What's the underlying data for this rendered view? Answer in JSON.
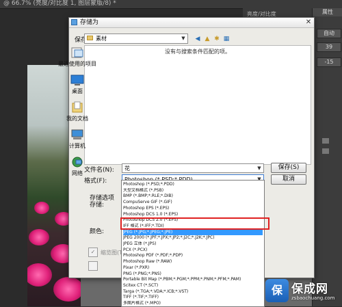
{
  "app": {
    "window_title": "@ 66.7% (亮度/对比度 1, 图层蒙版/8) *",
    "panel_tab": "属性",
    "panel_header": "亮度/对比度",
    "panel_btn": "自动",
    "panel_value_1": "39",
    "panel_value_2": "-15"
  },
  "dialog": {
    "title": "存储为",
    "close_glyph": "✕",
    "save_in_label": "保存在(I):",
    "save_in_value": "素材",
    "empty_message": "没有与搜索条件匹配的项。",
    "places": [
      {
        "label": "最近使用的项目",
        "icon": "recent-icon"
      },
      {
        "label": "桌面",
        "icon": "desktop-icon"
      },
      {
        "label": "我的文档",
        "icon": "documents-icon"
      },
      {
        "label": "计算机",
        "icon": "computer-icon"
      },
      {
        "label": "网络",
        "icon": "network-icon"
      }
    ],
    "filename_label": "文件名(N):",
    "filename_value": "花",
    "format_label": "格式(F):",
    "format_value": "Photoshop (*.PSD;*.PDD)",
    "save_button": "保存(S)",
    "cancel_button": "取消",
    "options_label": "存储选项",
    "storage_label": "存储:",
    "color_label": "颜色:",
    "thumbnail_label": "缩览图(T)",
    "format_options": [
      "Photoshop (*.PSD;*.PDD)",
      "大型文档格式 (*.PSB)",
      "BMP (*.BMP;*.RLE;*.DIB)",
      "CompuServe GIF (*.GIF)",
      "Photoshop EPS (*.EPS)",
      "Photoshop DCS 1.0 (*.EPS)",
      "Photoshop DCS 2.0 (*.EPS)",
      "IFF 格式 (*.IFF;*.TDI)",
      "JPEG (*.JPG;*.JPEG;*.JPE)",
      "JPEG 2000 (*.JPF;*.JPX;*.JP2;*.J2C;*.J2K;*.JPC)",
      "JPEG 立体 (*.JPS)",
      "PCX (*.PCX)",
      "Photoshop PDF (*.PDF;*.PDP)",
      "Photoshop Raw (*.RAW)",
      "Pixar (*.PXR)",
      "PNG (*.PNG;*.PNS)",
      "Portable Bit Map (*.PBM;*.PGM;*.PPM;*.PNM;*.PFM;*.PAM)",
      "Scitex CT (*.SCT)",
      "Targa (*.TGA;*.VDA;*.ICB;*.VST)",
      "TIFF (*.TIF;*.TIFF)",
      "多图片格式 (*.MPO)"
    ],
    "selected_index": 8
  },
  "watermark": {
    "badge": "保",
    "title": "保成网",
    "url": "zsbaochuang.com"
  },
  "colors": {
    "selection": "#3399ff",
    "highlight_box": "#e02020",
    "ps_background": "#2b2b2b"
  }
}
